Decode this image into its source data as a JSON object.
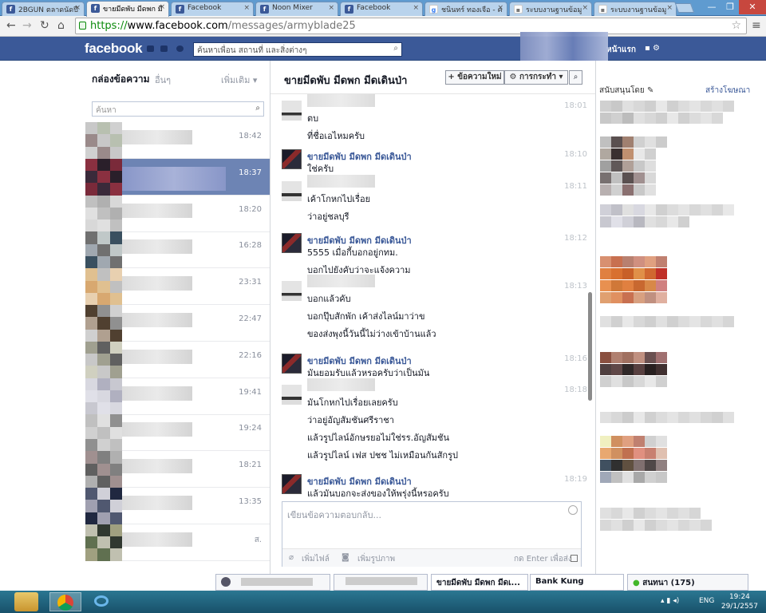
{
  "browser": {
    "tabs": [
      {
        "label": "2BGUN ตลาดนัดปื",
        "icon": "f"
      },
      {
        "label": "ขายมีดพับ มีดพก มี",
        "icon": "f",
        "active": true
      },
      {
        "label": "Facebook",
        "icon": "f"
      },
      {
        "label": "Noon Mixer",
        "icon": "f"
      },
      {
        "label": "Facebook",
        "icon": "f"
      },
      {
        "label": "ชนินทร์ ทองเจือ - ค",
        "icon": "g"
      },
      {
        "label": "ระบบงานฐานข้อมู",
        "icon": "d"
      },
      {
        "label": "ระบบงานฐานข้อมู",
        "icon": "d"
      }
    ],
    "url_scheme": "https://",
    "url_host": "www.facebook.com",
    "url_path": "/messages/armyblade25"
  },
  "fb_header": {
    "logo": "facebook",
    "search_placeholder": "ค้นหาเพื่อน สถานที่ และสิ่งต่างๆ",
    "home": "หน้าแรก"
  },
  "inbox": {
    "title": "กล่องข้อความ",
    "other": "อื่นๆ",
    "more": "เพิ่มเติม ▾",
    "search_placeholder": "ค้นหา",
    "threads": [
      {
        "time": "18:42"
      },
      {
        "time": "18:37",
        "selected": true
      },
      {
        "time": "18:20"
      },
      {
        "time": "16:28"
      },
      {
        "time": "23:31"
      },
      {
        "time": "22:47"
      },
      {
        "time": "22:16"
      },
      {
        "time": "19:41"
      },
      {
        "time": "19:24"
      },
      {
        "time": "18:21"
      },
      {
        "time": "13:35"
      },
      {
        "time": "ส."
      }
    ]
  },
  "conversation": {
    "title": "ขายมีดพับ มีดพก มีดเดินป่า",
    "new_message": "+ ข้อความใหม่",
    "actions": "⚙ การกระทำ ▾",
    "messages": [
      {
        "sender": "",
        "time": "18:01",
        "lines": [
          "ตบ",
          "ที่ชื่อเอไหมครับ"
        ]
      },
      {
        "sender": "ขายมีดพับ มีดพก มีดเดินป่า",
        "time": "18:10",
        "lines": [
          "ใช่ครับ"
        ]
      },
      {
        "sender": "",
        "time": "18:11",
        "lines": [
          "เค้าโกหกไปเรื่อย",
          "ว่าอยู่ชลบุรี"
        ]
      },
      {
        "sender": "ขายมีดพับ มีดพก มีดเดินป่า",
        "time": "18:12",
        "lines": [
          "5555 เมื่อกี้บอกอยู่กทม.",
          "บอกไปยังคับว่าจะแจ้งความ"
        ]
      },
      {
        "sender": "",
        "time": "18:13",
        "lines": [
          "บอกแล้วคับ",
          "บอกปุ๊บสักพัก เค้าส่งไลน์มาว่าข",
          "ของส่งพุงนี้วันนี้ไม่ว่างเข้าบ้านแล้ว"
        ]
      },
      {
        "sender": "ขายมีดพับ มีดพก มีดเดินป่า",
        "time": "18:16",
        "lines": [
          "มันยอมรับแล้วหรอครับว่าเป็นมัน"
        ]
      },
      {
        "sender": "",
        "time": "18:18",
        "lines": [
          "มันโกหกไปเรื่อยเลยครับ",
          "ว่าอยู่อัญสัมชันศรีราชา",
          "แล้วรูปไลน์อักษรยอไม่ใช่รร.อัญสัมชัน",
          "แล้วรูปไลน์ เฟส ปชช ไม่เหมือนกันสักรูป"
        ]
      },
      {
        "sender": "ขายมีดพับ มีดพก มีดเดินป่า",
        "time": "18:19",
        "lines": [
          "แล้วมันบอกจะส่งของให้พรุ่งนี้หรอครับ"
        ]
      }
    ],
    "composer_placeholder": "เขียนข้อความตอบกลับ...",
    "add_files": "เพิ่มไฟล์",
    "add_photos": "เพิ่มรูปภาพ",
    "enter_to_send": "กด Enter เพื่อส่ง"
  },
  "right": {
    "sponsored": "สนับสนุนโดย",
    "create_ad": "สร้างโฆษณา"
  },
  "chat_dock": {
    "tab1": "ขายมีดพับ มีดพก มีดเ...",
    "tab2": "Bank Kung",
    "chat": "สนทนา (175)"
  },
  "taskbar": {
    "lang": "ENG",
    "time": "19:24",
    "date": "29/1/2557"
  },
  "colors": {
    "fb_blue": "#3b5998",
    "selected_thread": "#6d84b4"
  }
}
